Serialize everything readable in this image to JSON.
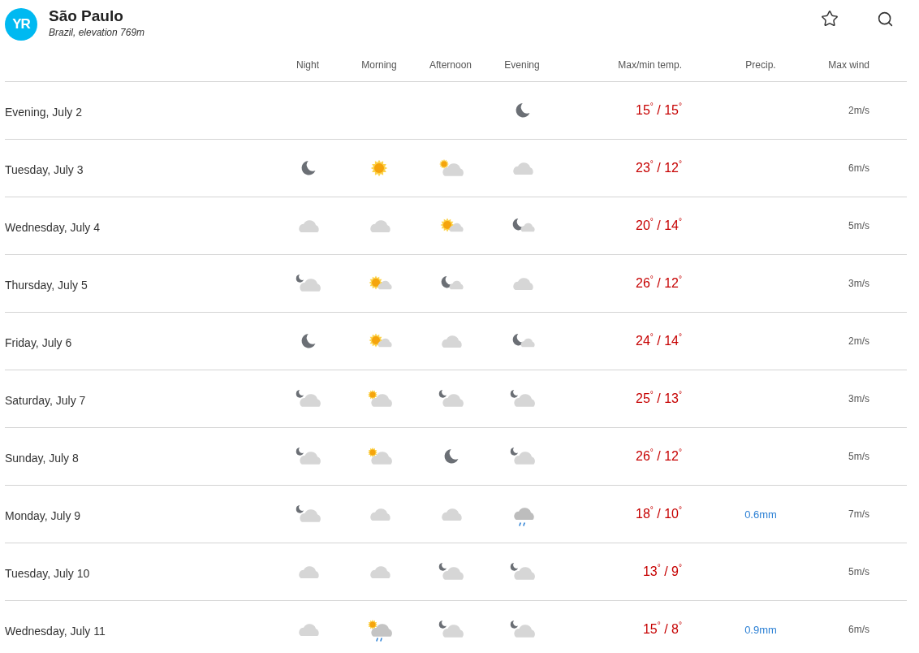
{
  "header": {
    "logo": "YR",
    "title": "São Paulo",
    "subtitle": "Brazil, elevation 769m"
  },
  "columns": {
    "periods": [
      "Night",
      "Morning",
      "Afternoon",
      "Evening"
    ],
    "temp": "Max/min temp.",
    "precip": "Precip.",
    "wind": "Max wind"
  },
  "rows": [
    {
      "date": "Evening, July 2",
      "periods": [
        {
          "kind": "none"
        },
        {
          "kind": "none"
        },
        {
          "kind": "none"
        },
        {
          "kind": "moon"
        }
      ],
      "temp": "15$^{°}$ / 15$^{°}$",
      "wind": "2m/s"
    },
    {
      "date": "Tuesday, July 3",
      "periods": [
        {
          "kind": "moon"
        },
        {
          "kind": "sun"
        },
        {
          "kind": "partly-sun"
        },
        {
          "kind": "cloud"
        }
      ],
      "temp": "23$^{°}$ / 12$^{°}$",
      "wind": "6m/s"
    },
    {
      "date": "Wednesday, July 4",
      "periods": [
        {
          "kind": "cloud"
        },
        {
          "kind": "cloud"
        },
        {
          "kind": "sun-small-cloud"
        },
        {
          "kind": "moon-small-cloud"
        }
      ],
      "temp": "20$^{°}$ / 14$^{°}$",
      "wind": "5m/s"
    },
    {
      "date": "Thursday, July 5",
      "periods": [
        {
          "kind": "partly-moon"
        },
        {
          "kind": "sun-small-cloud"
        },
        {
          "kind": "moon-small-cloud"
        },
        {
          "kind": "cloud"
        }
      ],
      "temp": "26$^{°}$ / 12$^{°}$",
      "wind": "3m/s"
    },
    {
      "date": "Friday, July 6",
      "periods": [
        {
          "kind": "moon"
        },
        {
          "kind": "sun-small-cloud"
        },
        {
          "kind": "cloud"
        },
        {
          "kind": "moon-small-cloud"
        }
      ],
      "temp": "24$^{°}$ / 14$^{°}$",
      "wind": "2m/s"
    },
    {
      "date": "Saturday, July 7",
      "periods": [
        {
          "kind": "partly-moon"
        },
        {
          "kind": "partly-sun"
        },
        {
          "kind": "partly-moon"
        },
        {
          "kind": "partly-moon"
        }
      ],
      "temp": "25$^{°}$ / 13$^{°}$",
      "wind": "3m/s"
    },
    {
      "date": "Sunday, July 8",
      "periods": [
        {
          "kind": "partly-moon"
        },
        {
          "kind": "partly-sun"
        },
        {
          "kind": "moon"
        },
        {
          "kind": "partly-moon"
        }
      ],
      "temp": "26$^{°}$ / 12$^{°}$",
      "wind": "5m/s"
    },
    {
      "date": "Monday, July 9",
      "periods": [
        {
          "kind": "partly-moon"
        },
        {
          "kind": "cloud"
        },
        {
          "kind": "cloud"
        },
        {
          "kind": "rain"
        }
      ],
      "temp": "18$^{°}$ / 10$^{°}$",
      "precip": "0.6mm",
      "wind": "7m/s"
    },
    {
      "date": "Tuesday, July 10",
      "periods": [
        {
          "kind": "cloud"
        },
        {
          "kind": "cloud"
        },
        {
          "kind": "partly-moon"
        },
        {
          "kind": "partly-moon"
        }
      ],
      "temp": "13$^{°}$ / 9$^{°}$",
      "wind": "5m/s"
    },
    {
      "date": "Wednesday, July 11",
      "periods": [
        {
          "kind": "cloud"
        },
        {
          "kind": "sun-rain"
        },
        {
          "kind": "partly-moon"
        },
        {
          "kind": "partly-moon"
        }
      ],
      "temp": "15$^{°}$ / 8$^{°}$",
      "precip": "0.9mm",
      "wind": "6m/s"
    }
  ]
}
